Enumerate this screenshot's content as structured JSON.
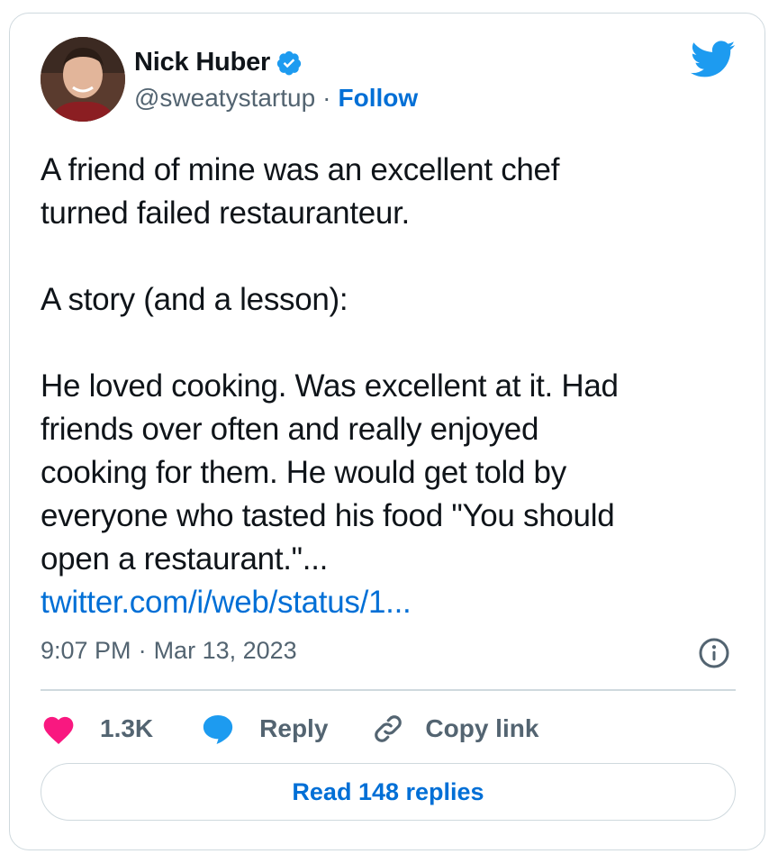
{
  "author": {
    "name": "Nick Huber",
    "handle": "@sweatystartup",
    "separator": "·",
    "follow_label": "Follow"
  },
  "tweet": {
    "paragraphs": [
      [
        "A friend of mine was an excellent chef",
        "turned failed restauranteur."
      ],
      [
        "A story (and a lesson):"
      ],
      [
        "He loved cooking. Was excellent at it. Had",
        "friends over often and really enjoyed",
        "cooking for them. He would get told by",
        "everyone who tasted his food \"You should",
        "open a restaurant.\"..."
      ]
    ],
    "link": "twitter.com/i/web/status/1..."
  },
  "meta": {
    "time": "9:07 PM",
    "separator": "·",
    "date": "Mar 13, 2023"
  },
  "actions": {
    "likes": "1.3K",
    "reply_label": "Reply",
    "copy_link_label": "Copy link"
  },
  "read_replies_label": "Read 148 replies",
  "colors": {
    "accent": "#006fd6",
    "twitter_blue": "#1d9bf0",
    "like_pink": "#f91880",
    "muted": "#536471",
    "border": "#cfd9de"
  },
  "icons": {
    "verified": "verified-badge-icon",
    "brand": "twitter-bird-icon",
    "info": "info-icon",
    "like": "heart-icon",
    "reply": "speech-bubble-icon",
    "copy_link": "link-icon"
  }
}
